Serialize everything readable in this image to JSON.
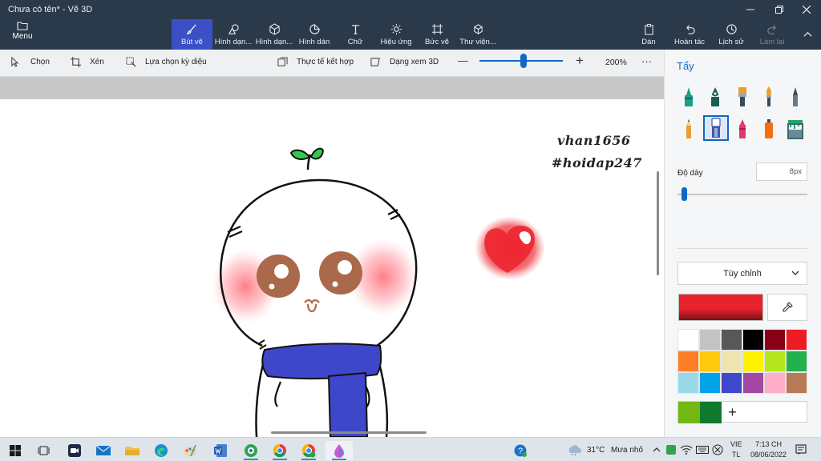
{
  "window": {
    "title": "Chưa có tên* - Vẽ 3D"
  },
  "ribbon": {
    "menu_label": "Menu",
    "tools": [
      {
        "label": "Bút vẽ",
        "icon": "brush-icon"
      },
      {
        "label": "Hình dạn...",
        "icon": "2d-shapes-icon"
      },
      {
        "label": "Hình dạn...",
        "icon": "3d-shapes-icon"
      },
      {
        "label": "Hình dán",
        "icon": "stickers-icon"
      },
      {
        "label": "Chữ",
        "icon": "text-icon"
      },
      {
        "label": "Hiệu ứng",
        "icon": "effects-icon"
      },
      {
        "label": "Bức vẽ",
        "icon": "canvas-icon"
      },
      {
        "label": "Thư viện...",
        "icon": "3d-library-icon"
      }
    ],
    "actions": [
      {
        "label": "Dán",
        "icon": "paste-icon"
      },
      {
        "label": "Hoàn tác",
        "icon": "undo-icon"
      },
      {
        "label": "Lịch sử",
        "icon": "history-icon"
      },
      {
        "label": "Làm lại",
        "icon": "redo-icon"
      }
    ]
  },
  "toolbar": {
    "select_label": "Chọn",
    "crop_label": "Xén",
    "magic_select_label": "Lựa chọn kỳ diệu",
    "mixed_reality_label": "Thực tế kết hợp",
    "view_3d_label": "Dạng xem 3D",
    "zoom_minus": "—",
    "zoom_plus": "+",
    "zoom_level": "200%",
    "more": "···"
  },
  "canvas": {
    "text_line_1": "vhan1656",
    "text_line_2": "#hoidap247"
  },
  "panel": {
    "title": "Tẩy",
    "thickness_label": "Độ dày",
    "thickness_value": "8px",
    "thickness_fraction": 0.05,
    "color_mode": "Tùy chỉnh",
    "current_color": "#e8232e",
    "add_color_symbol": "+",
    "brushes": [
      {
        "name": "marker-icon",
        "color": "#1a9e8a"
      },
      {
        "name": "calligraphy-pen-icon",
        "color": "#1a5e52"
      },
      {
        "name": "oil-brush-icon",
        "color": "#e8a030"
      },
      {
        "name": "watercolor-icon",
        "color": "#e8a030"
      },
      {
        "name": "pixel-pen-icon",
        "color": "#3a4a5a"
      },
      {
        "name": "pencil-icon",
        "color": "#e8a030"
      },
      {
        "name": "eraser-icon",
        "color": "#3a5ab0"
      },
      {
        "name": "crayon-icon",
        "color": "#e03a6a"
      },
      {
        "name": "spray-can-icon",
        "color": "#f07010"
      },
      {
        "name": "fill-icon",
        "color": "#3a6a6a"
      }
    ],
    "palette": [
      "#ffffff",
      "#c3c3c3",
      "#585858",
      "#000000",
      "#880015",
      "#ed1c24",
      "#ff7f27",
      "#ffc90e",
      "#efe4b0",
      "#fff200",
      "#b5e61d",
      "#22b14c",
      "#99d9ea",
      "#00a2e8",
      "#3f48cc",
      "#a349a4",
      "#ffaec9",
      "#b97a57"
    ],
    "custom_colors": [
      "#74b814",
      "#0f7a2e"
    ]
  },
  "taskbar": {
    "apps": [
      "windows-start-icon",
      "task-view-icon",
      "zoom-icon",
      "mail-icon",
      "file-explorer-icon",
      "edge-icon",
      "paint-icon",
      "word-icon",
      "app-icon",
      "chrome-icon",
      "chrome-profile-icon",
      "paint-3d-icon"
    ],
    "weather_temp": "31°C",
    "weather_desc": "Mưa nhỏ",
    "lang_line_1": "VIE",
    "lang_line_2": "TL",
    "time": "7:13 CH",
    "date": "08/06/2022"
  }
}
